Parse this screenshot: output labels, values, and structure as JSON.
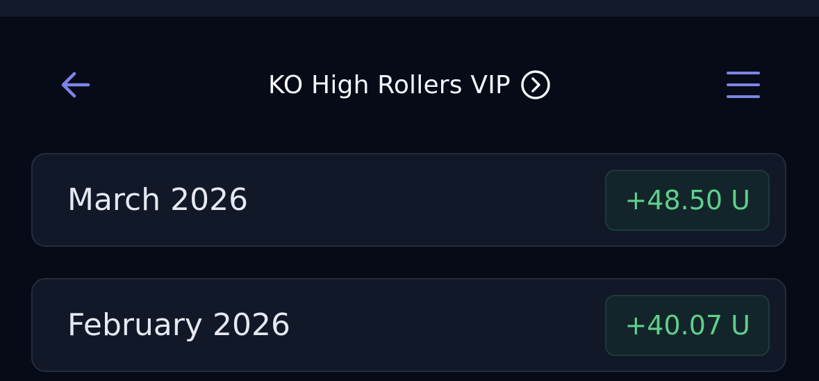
{
  "header": {
    "title": "KO High Rollers VIP",
    "back_icon": "arrow-left-icon",
    "info_icon": "chevron-right-circle-icon",
    "menu_icon": "hamburger-menu-icon"
  },
  "colors": {
    "background": "#070b17",
    "card_background": "#111827",
    "accent": "#7c86e6",
    "positive": "#5fd08a"
  },
  "months": [
    {
      "label": "March 2026",
      "value": "+48.50 U"
    },
    {
      "label": "February 2026",
      "value": "+40.07 U"
    }
  ]
}
